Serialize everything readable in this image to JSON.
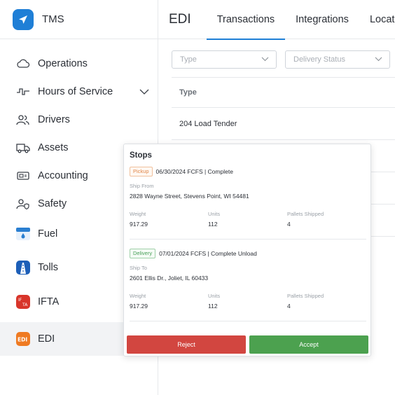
{
  "app": {
    "name": "TMS"
  },
  "sidebar": {
    "items": [
      {
        "label": "Operations",
        "icon": "cloud-icon"
      },
      {
        "label": "Hours of Service",
        "icon": "pulse-icon",
        "expandable": true
      },
      {
        "label": "Drivers",
        "icon": "users-icon"
      },
      {
        "label": "Assets",
        "icon": "truck-icon"
      },
      {
        "label": "Accounting",
        "icon": "money-icon"
      },
      {
        "label": "Safety",
        "icon": "safety-user-icon"
      },
      {
        "label": "Fuel",
        "icon": "fuel-icon"
      },
      {
        "label": "Tolls",
        "icon": "tolls-road-icon"
      },
      {
        "label": "IFTA",
        "icon": "ifta-icon"
      },
      {
        "label": "EDI",
        "icon": "edi-icon",
        "active": true
      }
    ]
  },
  "header": {
    "title": "EDI",
    "tabs": [
      {
        "label": "Transactions",
        "active": true
      },
      {
        "label": "Integrations"
      },
      {
        "label": "Locations"
      }
    ]
  },
  "filters": {
    "type_placeholder": "Type",
    "status_placeholder": "Delivery Status"
  },
  "table": {
    "header": "Type",
    "rows": [
      "204 Load Tender"
    ]
  },
  "popover": {
    "title": "Stops",
    "stops": [
      {
        "badge": "Pickup",
        "summary": "06/30/2024 FCFS | Complete",
        "address_label": "Ship From",
        "address": "2828 Wayne Street, Stevens Point, WI 54481",
        "weight_label": "Weight",
        "weight": "917.29",
        "units_label": "Units",
        "units": "112",
        "pallets_label": "Pallets Shipped",
        "pallets": "4"
      },
      {
        "badge": "Delivery",
        "summary": "07/01/2024 FCFS | Complete Unload",
        "address_label": "Ship To",
        "address": "2601 Ellis Dr., Joliet, IL 60433",
        "weight_label": "Weight",
        "weight": "917.29",
        "units_label": "Units",
        "units": "112",
        "pallets_label": "Pallets Shipped",
        "pallets": "4"
      }
    ],
    "reject_label": "Reject",
    "accept_label": "Accept"
  },
  "colors": {
    "primary": "#1f7fd6",
    "reject": "#d24640",
    "accept": "#4ca14f",
    "pickup": "#e0874b",
    "delivery": "#4aa05a"
  }
}
